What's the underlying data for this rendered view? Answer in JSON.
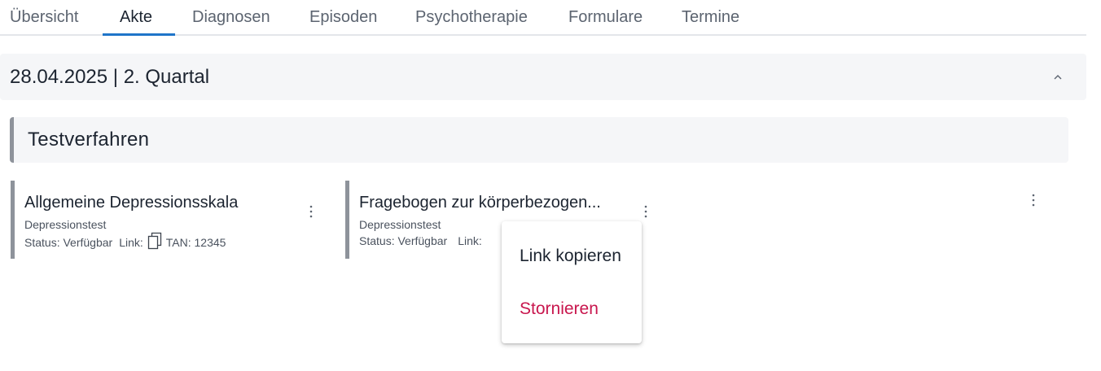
{
  "tabs": [
    {
      "label": "Übersicht",
      "active": false
    },
    {
      "label": "Akte",
      "active": true
    },
    {
      "label": "Diagnosen",
      "active": false
    },
    {
      "label": "Episoden",
      "active": false
    },
    {
      "label": "Psychotherapie",
      "active": false
    },
    {
      "label": "Formulare",
      "active": false
    },
    {
      "label": "Termine",
      "active": false
    }
  ],
  "section": {
    "title": "28.04.2025 | 2. Quartal",
    "toggle_icon": "chevron-up-icon"
  },
  "group": {
    "title": "Testverfahren"
  },
  "cards": [
    {
      "title": "Allgemeine Depressionsskala",
      "category": "Depressionstest",
      "status": "Status: Verfügbar",
      "link_label": "Link:",
      "link_icon": "copy-icon",
      "tan": "TAN: 12345"
    },
    {
      "title": "Fragebogen zur körperbezogen...",
      "category": "Depressionstest",
      "status": "Status: Verfügbar",
      "link_label": "Link:"
    }
  ],
  "context_menu": {
    "items": [
      {
        "label": "Link kopieren",
        "color": "#1c2430"
      },
      {
        "label": "Stornieren",
        "color": "#c8164d"
      }
    ]
  },
  "colors": {
    "accent": "#1f75c9",
    "danger": "#c8164d",
    "card_bar": "#8e939b",
    "panel_bg": "#f5f6f8"
  }
}
